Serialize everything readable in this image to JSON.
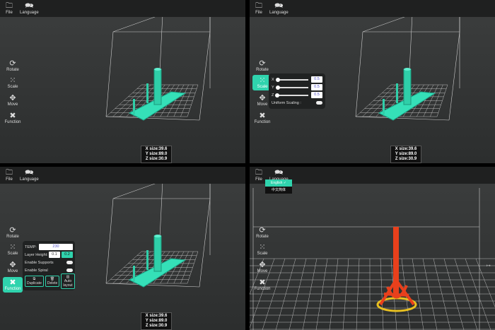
{
  "topbar": {
    "file": "File",
    "language": "Language"
  },
  "sidebar": {
    "rotate": "Rotate",
    "scale": "Scale",
    "move": "Move",
    "function": "Function"
  },
  "size": {
    "x": "X size:39.6",
    "y": "Y size:89.0",
    "z": "Z size:30.9"
  },
  "scale_panel": {
    "x_label": "X",
    "y_label": "Y",
    "z_label": "Z",
    "x": "0.5",
    "y": "0.5",
    "z": "0.5",
    "uniform": "Uniform Scaling :"
  },
  "function_panel": {
    "temp_label": "TEMP:",
    "temp": "230",
    "layer_label": "Layer Height:",
    "layer_a": "0.1",
    "layer_b": "0.2",
    "supports": "Enable Supports",
    "spiral": "Enable Spiral",
    "duplicate": "Duplicate",
    "delete": "Delete",
    "auto_layout": "Auto layout"
  },
  "language_menu": {
    "english": "English ✓",
    "chinese": "中文简体"
  },
  "colors": {
    "accent": "#2fd3ad",
    "model_red": "#e8401c"
  }
}
